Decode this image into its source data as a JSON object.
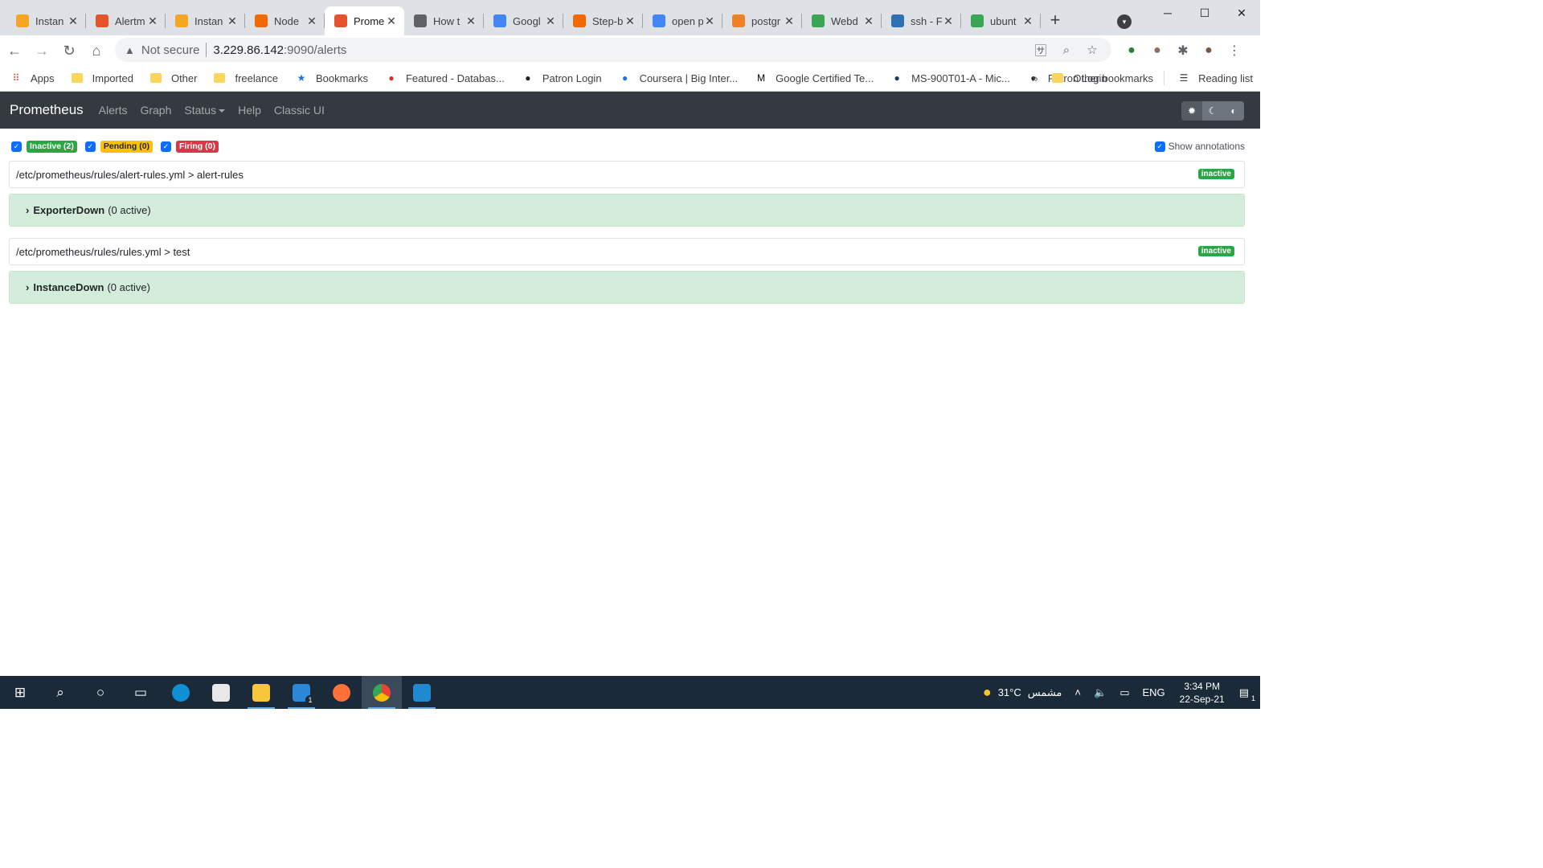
{
  "browser": {
    "tabs": [
      {
        "title": "Instan",
        "icon": "aws-cube-icon",
        "color": "#f5a623",
        "active": false
      },
      {
        "title": "Alertm",
        "icon": "prometheus-flame-icon",
        "color": "#e6522c",
        "active": false
      },
      {
        "title": "Instan",
        "icon": "aws-cube-icon",
        "color": "#f5a623",
        "active": false
      },
      {
        "title": "Node",
        "icon": "grafana-icon",
        "color": "#f46800",
        "active": false
      },
      {
        "title": "Prome",
        "icon": "prometheus-flame-icon",
        "color": "#e6522c",
        "active": true
      },
      {
        "title": "How t",
        "icon": "page-icon",
        "color": "#5f6368",
        "active": false
      },
      {
        "title": "Googl",
        "icon": "google-g-icon",
        "color": "#4285f4",
        "active": false
      },
      {
        "title": "Step-b",
        "icon": "grafana-icon",
        "color": "#f46800",
        "active": false
      },
      {
        "title": "open p",
        "icon": "google-g-icon",
        "color": "#4285f4",
        "active": false
      },
      {
        "title": "postgr",
        "icon": "stackoverflow-icon",
        "color": "#f48024",
        "active": false
      },
      {
        "title": "Webd",
        "icon": "webdock-icon",
        "color": "#3aa655",
        "active": false
      },
      {
        "title": "ssh - F",
        "icon": "unix-se-icon",
        "color": "#2f6fb3",
        "active": false
      },
      {
        "title": "ubunt",
        "icon": "askubuntu-icon",
        "color": "#3aa655",
        "active": false
      }
    ],
    "address": {
      "security": "Not secure",
      "host": "3.229.86.142",
      "path": ":9090/alerts"
    },
    "bookmarks": [
      {
        "label": "Apps",
        "icon": "apps-grid-icon"
      },
      {
        "label": "Imported",
        "icon": "folder-icon"
      },
      {
        "label": "Other",
        "icon": "folder-icon"
      },
      {
        "label": "freelance",
        "icon": "folder-icon"
      },
      {
        "label": "Bookmarks",
        "icon": "star-icon"
      },
      {
        "label": "Featured - Databas...",
        "icon": "swirl-icon"
      },
      {
        "label": "Patron Login",
        "icon": "patron-icon"
      },
      {
        "label": "Coursera | Big Inter...",
        "icon": "coursera-icon"
      },
      {
        "label": "Google Certified Te...",
        "icon": "medium-m-icon"
      },
      {
        "label": "MS-900T01-A - Mic...",
        "icon": "ms-icon"
      },
      {
        "label": "Patron Login",
        "icon": "patron-icon"
      }
    ],
    "bookmarks_more": "»",
    "other_bookmarks": "Other bookmarks",
    "reading_list": "Reading list"
  },
  "prometheus": {
    "brand": "Prometheus",
    "nav": [
      "Alerts",
      "Graph",
      "Status",
      "Help",
      "Classic UI"
    ],
    "filters": [
      {
        "label": "Inactive (2)",
        "state": "inactive",
        "checked": true
      },
      {
        "label": "Pending (0)",
        "state": "pending",
        "checked": true
      },
      {
        "label": "Firing (0)",
        "state": "firing",
        "checked": true
      }
    ],
    "show_annotations": "Show annotations",
    "groups": [
      {
        "path": "/etc/prometheus/rules/alert-rules.yml > alert-rules",
        "state": "inactive",
        "rule": {
          "name": "ExporterDown",
          "count": "(0 active)"
        }
      },
      {
        "path": "/etc/prometheus/rules/rules.yml > test",
        "state": "inactive",
        "rule": {
          "name": "InstanceDown",
          "count": "(0 active)"
        }
      }
    ]
  },
  "taskbar": {
    "weather": "31°C",
    "weather_label": "مشمس",
    "language": "ENG",
    "time": "3:34 PM",
    "date": "22-Sep-21",
    "mail_badge": "1",
    "notif_badge": "1"
  }
}
